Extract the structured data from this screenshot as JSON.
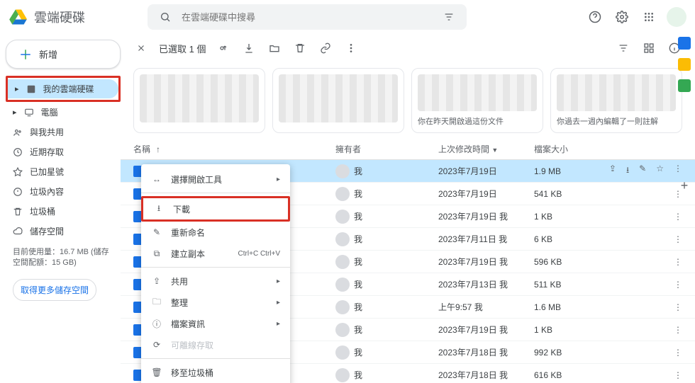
{
  "brand": "雲端硬碟",
  "search": {
    "placeholder": "在雲端硬碟中搜尋"
  },
  "new_label": "新增",
  "sidebar": {
    "items": [
      {
        "label": "我的雲端硬碟"
      },
      {
        "label": "電腦"
      },
      {
        "label": "與我共用"
      },
      {
        "label": "近期存取"
      },
      {
        "label": "已加星號"
      },
      {
        "label": "垃圾內容"
      },
      {
        "label": "垃圾桶"
      },
      {
        "label": "儲存空間"
      }
    ],
    "storage_line1": "目前使用量：16.7 MB (儲存",
    "storage_line2": "空間配額：15 GB)",
    "storage_button": "取得更多儲存空間"
  },
  "toolbar": {
    "selected": "已選取 1 個"
  },
  "suggestions": [
    {
      "label": ""
    },
    {
      "label": ""
    },
    {
      "label": "你在昨天開啟過這份文件"
    },
    {
      "label": "你過去一週內編輯了一則註解"
    }
  ],
  "columns": {
    "name": "名稱",
    "owner": "擁有者",
    "modified": "上次修改時間",
    "size": "檔案大小"
  },
  "rows": [
    {
      "owner": "我",
      "modified": "2023年7月19日",
      "size": "1.9 MB",
      "selected": true
    },
    {
      "owner": "我",
      "modified": "2023年7月19日",
      "size": "541 KB",
      "selected": false
    },
    {
      "owner": "我",
      "modified": "2023年7月19日 我",
      "size": "1 KB",
      "selected": false
    },
    {
      "owner": "我",
      "modified": "2023年7月11日 我",
      "size": "6 KB",
      "selected": false
    },
    {
      "owner": "我",
      "modified": "2023年7月19日 我",
      "size": "596 KB",
      "selected": false
    },
    {
      "owner": "我",
      "modified": "2023年7月13日 我",
      "size": "511 KB",
      "selected": false
    },
    {
      "owner": "我",
      "modified": "上午9:57 我",
      "size": "1.6 MB",
      "selected": false
    },
    {
      "owner": "我",
      "modified": "2023年7月19日 我",
      "size": "1 KB",
      "selected": false
    },
    {
      "owner": "我",
      "modified": "2023年7月18日 我",
      "size": "992 KB",
      "selected": false
    },
    {
      "owner": "我",
      "modified": "2023年7月18日 我",
      "size": "616 KB",
      "selected": false
    }
  ],
  "context_menu": {
    "open_with": "選擇開啟工具",
    "download": "下載",
    "rename": "重新命名",
    "make_copy": "建立副本",
    "make_copy_kbd": "Ctrl+C Ctrl+V",
    "share": "共用",
    "organize": "整理",
    "file_info": "檔案資訊",
    "offline": "可離線存取",
    "trash": "移至垃圾桶"
  }
}
